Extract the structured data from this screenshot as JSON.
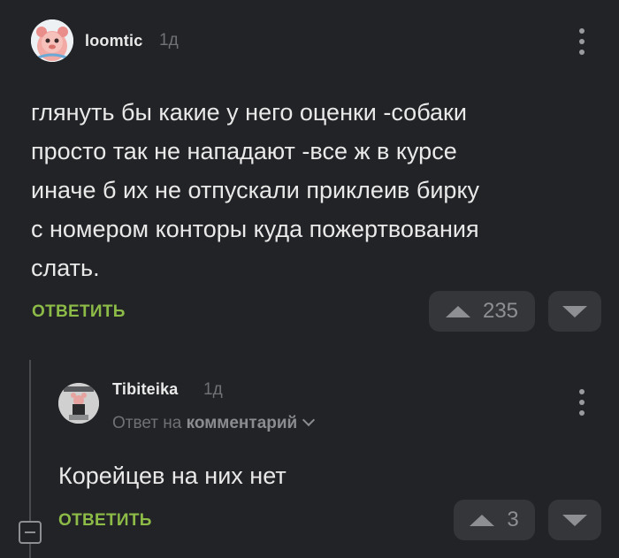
{
  "comment": {
    "username": "loomtic",
    "time": "1д",
    "text": "глянуть бы какие у него оценки -собаки\nпросто так не нападают -все ж в курсе\nиначе б их не отпускали приклеив бирку\nс номером конторы куда пожертвования\nслать.",
    "reply_label": "ОТВЕТИТЬ",
    "votes": "235"
  },
  "reply": {
    "username": "Tibiteika",
    "time": "1д",
    "reply_to_prefix": "Ответ на",
    "reply_to_link": "комментарий",
    "text": "Корейцев на них нет",
    "reply_label": "ОТВЕТИТЬ",
    "votes": "3"
  },
  "colors": {
    "background": "#222326",
    "accent_green": "#8dbb47",
    "vote_box": "#353639",
    "muted": "#6f7175"
  },
  "icons": {
    "menu": "kebab-menu-icon",
    "upvote": "upvote-icon",
    "downvote": "downvote-icon",
    "collapse": "collapse-thread-icon",
    "chevron": "chevron-down-icon"
  }
}
